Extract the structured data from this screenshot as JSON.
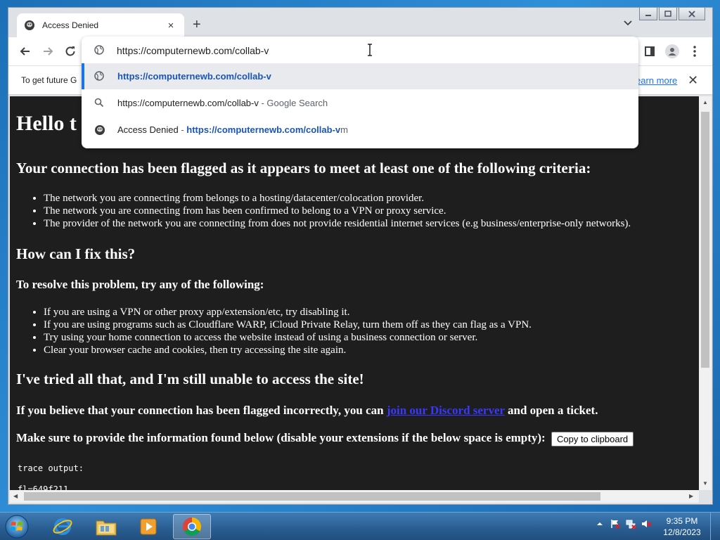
{
  "browser": {
    "tab": {
      "title": "Access Denied",
      "close": "×"
    },
    "new_tab": "+",
    "address": {
      "value": "https://computernewb.com/collab-v"
    },
    "suggestions": [
      {
        "url": "https://computernewb.com/collab-v",
        "icon": "globe-icon"
      },
      {
        "text": "https://computernewb.com/collab-v",
        "suffix": " - Google Search",
        "icon": "search-icon"
      },
      {
        "title": "Access Denied",
        "sep": " - ",
        "url": "https://computernewb.com/collab-v",
        "tail": "m",
        "icon": "site-favicon-icon"
      }
    ],
    "infobar": {
      "text": "To get future G",
      "learn_more": "earn more",
      "close": "✕"
    }
  },
  "page": {
    "h1": "Hello t",
    "flagged_heading": "Your connection has been flagged as it appears to meet at least one of the following criteria:",
    "criteria": [
      "The network you are connecting from belongs to a hosting/datacenter/colocation provider.",
      "The network you are connecting from has been confirmed to belong to a VPN or proxy service.",
      "The provider of the network you are connecting from does not provide residential internet services (e.g business/enterprise-only networks)."
    ],
    "fix_heading": "How can I fix this?",
    "resolve_heading": "To resolve this problem, try any of the following:",
    "fixes": [
      "If you are using a VPN or other proxy app/extension/etc, try disabling it.",
      "If you are using programs such as Cloudflare WARP, iCloud Private Relay, turn them off as they can flag as a VPN.",
      "Try using your home connection to access the website instead of using a business connection or server.",
      "Clear your browser cache and cookies, then try accessing the site again."
    ],
    "tried_heading": "I've tried all that, and I'm still unable to access the site!",
    "believe_pre": "If you believe that your connection has been flagged incorrectly, you can ",
    "believe_link": "join our Discord server",
    "believe_post": " and open a ticket.",
    "provide_text": "Make sure to provide the information found below (disable your extensions if the below space is empty):",
    "copy_button": "Copy to clipboard",
    "trace_label": "trace output:",
    "trace_line1": "fl=649f211"
  },
  "taskbar": {
    "clock_time": "9:35 PM",
    "clock_date": "12/8/2023"
  }
}
